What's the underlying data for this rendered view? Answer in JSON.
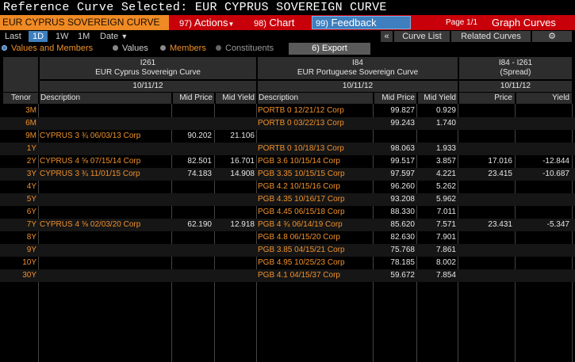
{
  "title": "Reference Curve Selected: EUR CYPRUS SOVEREIGN CURVE",
  "toolbar": {
    "curve_name": "EUR CYPRUS SOVEREIGN CURVE",
    "actions_num": "97)",
    "actions_label": "Actions",
    "chart_num": "98)",
    "chart_label": "Chart",
    "feedback_num": "99)",
    "feedback_label": "Feedback",
    "page_info": "Page 1/1",
    "graph_curves": "Graph Curves"
  },
  "tabs": {
    "last": "Last",
    "d1": "1D",
    "w1": "1W",
    "m1": "1M",
    "date": "Date",
    "collapse": "«",
    "curve_list": "Curve List",
    "related_curves": "Related Curves",
    "gear": "⚙"
  },
  "options": {
    "values_and_members": "Values and Members",
    "values": "Values",
    "members": "Members",
    "constituents": "Constituents",
    "export": "6) Export"
  },
  "colors": {
    "accent_orange": "#f0902a",
    "toolbar_red": "#c8000a",
    "blue_active": "#3d7fbf"
  },
  "groups": {
    "cyprus": {
      "id": "I261",
      "name": "EUR Cyprus Sovereign Curve",
      "date": "10/11/12"
    },
    "portugal": {
      "id": "I84",
      "name": "EUR Portuguese Sovereign Curve",
      "date": "10/11/12"
    },
    "spread": {
      "id": "I84 - I261",
      "name": "(Spread)",
      "date": "10/11/12"
    }
  },
  "columns": {
    "tenor": "Tenor",
    "description": "Description",
    "mid_price": "Mid Price",
    "mid_yield": "Mid Yield",
    "description2": "Description",
    "mid_price2": "Mid Price",
    "mid_yield2": "Mid Yield",
    "price": "Price",
    "yield": "Yield"
  },
  "rows": [
    {
      "tenor": "3M",
      "cy_desc": "",
      "cy_price": "",
      "cy_yield": "",
      "pt_desc": "PORTB 0 12/21/12 Corp",
      "pt_price": "99.827",
      "pt_yield": "0.929",
      "sp_price": "",
      "sp_yield": ""
    },
    {
      "tenor": "6M",
      "cy_desc": "",
      "cy_price": "",
      "cy_yield": "",
      "pt_desc": "PORTB 0 03/22/13 Corp",
      "pt_price": "99.243",
      "pt_yield": "1.740",
      "sp_price": "",
      "sp_yield": ""
    },
    {
      "tenor": "9M",
      "cy_desc": "CYPRUS 3 ¾ 06/03/13  Corp",
      "cy_price": "90.202",
      "cy_yield": "21.106",
      "pt_desc": "",
      "pt_price": "",
      "pt_yield": "",
      "sp_price": "",
      "sp_yield": ""
    },
    {
      "tenor": "1Y",
      "cy_desc": "",
      "cy_price": "",
      "cy_yield": "",
      "pt_desc": "PORTB 0 10/18/13 Corp",
      "pt_price": "98.063",
      "pt_yield": "1.933",
      "sp_price": "",
      "sp_yield": ""
    },
    {
      "tenor": "2Y",
      "cy_desc": "CYPRUS 4 ⅝ 07/15/14  Corp",
      "cy_price": "82.501",
      "cy_yield": "16.701",
      "pt_desc": "PGB 3.6 10/15/14 Corp",
      "pt_price": "99.517",
      "pt_yield": "3.857",
      "sp_price": "17.016",
      "sp_yield": "-12.844"
    },
    {
      "tenor": "3Y",
      "cy_desc": "CYPRUS 3 ¾ 11/01/15  Corp",
      "cy_price": "74.183",
      "cy_yield": "14.908",
      "pt_desc": "PGB 3.35 10/15/15 Corp",
      "pt_price": "97.597",
      "pt_yield": "4.221",
      "sp_price": "23.415",
      "sp_yield": "-10.687"
    },
    {
      "tenor": "4Y",
      "cy_desc": "",
      "cy_price": "",
      "cy_yield": "",
      "pt_desc": "PGB 4.2 10/15/16 Corp",
      "pt_price": "96.260",
      "pt_yield": "5.262",
      "sp_price": "",
      "sp_yield": ""
    },
    {
      "tenor": "5Y",
      "cy_desc": "",
      "cy_price": "",
      "cy_yield": "",
      "pt_desc": "PGB 4.35 10/16/17 Corp",
      "pt_price": "93.208",
      "pt_yield": "5.962",
      "sp_price": "",
      "sp_yield": ""
    },
    {
      "tenor": "6Y",
      "cy_desc": "",
      "cy_price": "",
      "cy_yield": "",
      "pt_desc": "PGB 4.45 06/15/18 Corp",
      "pt_price": "88.330",
      "pt_yield": "7.011",
      "sp_price": "",
      "sp_yield": ""
    },
    {
      "tenor": "7Y",
      "cy_desc": "CYPRUS 4 ⅝ 02/03/20  Corp",
      "cy_price": "62.190",
      "cy_yield": "12.918",
      "pt_desc": "PGB 4 ¾ 06/14/19  Corp",
      "pt_price": "85.620",
      "pt_yield": "7.571",
      "sp_price": "23.431",
      "sp_yield": "-5.347"
    },
    {
      "tenor": "8Y",
      "cy_desc": "",
      "cy_price": "",
      "cy_yield": "",
      "pt_desc": "PGB 4.8 06/15/20 Corp",
      "pt_price": "82.630",
      "pt_yield": "7.901",
      "sp_price": "",
      "sp_yield": ""
    },
    {
      "tenor": "9Y",
      "cy_desc": "",
      "cy_price": "",
      "cy_yield": "",
      "pt_desc": "PGB 3.85 04/15/21 Corp",
      "pt_price": "75.768",
      "pt_yield": "7.861",
      "sp_price": "",
      "sp_yield": ""
    },
    {
      "tenor": "10Y",
      "cy_desc": "",
      "cy_price": "",
      "cy_yield": "",
      "pt_desc": "PGB 4.95 10/25/23 Corp",
      "pt_price": "78.185",
      "pt_yield": "8.002",
      "sp_price": "",
      "sp_yield": ""
    },
    {
      "tenor": "30Y",
      "cy_desc": "",
      "cy_price": "",
      "cy_yield": "",
      "pt_desc": "PGB 4.1 04/15/37 Corp",
      "pt_price": "59.672",
      "pt_yield": "7.854",
      "sp_price": "",
      "sp_yield": ""
    }
  ]
}
